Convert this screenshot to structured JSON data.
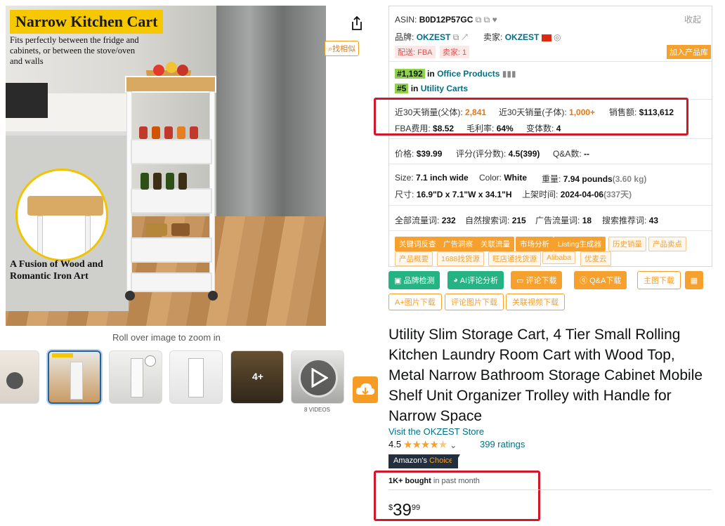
{
  "image": {
    "title": "Narrow Kitchen Cart",
    "subtitle": "Fits perfectly between the fridge and cabinets, or between the stove/oven and walls",
    "caption": "A Fusion of Wood and Romantic Iron Art",
    "roll_over": "Roll over image to zoom in",
    "similar_btn": "找相似",
    "videos_label": "8 VIDEOS",
    "thumb_more": "4+"
  },
  "panel": {
    "asin_label": "ASIN:",
    "asin": "B0D12P57GC",
    "collapse": "收起",
    "brand_label": "品牌:",
    "brand": "OKZEST",
    "seller_label": "卖家:",
    "seller": "OKZEST",
    "tag_fba": "配送: FBA",
    "tag_sellers": "卖家: 1",
    "add_btn": "加入产品库",
    "rank1": "#1,192",
    "rank1_in": "in",
    "rank1_cat": "Office Products",
    "rank2": "#5",
    "rank2_in": "in",
    "rank2_cat": "Utility Carts",
    "sales_parent_label": "近30天销量(父体):",
    "sales_parent": "2,841",
    "sales_child_label": "近30天销量(子体):",
    "sales_child": "1,000+",
    "revenue_label": "销售额:",
    "revenue": "$113,612",
    "fba_label": "FBA费用:",
    "fba": "$8.52",
    "margin_label": "毛利率:",
    "margin": "64%",
    "variants_label": "变体数:",
    "variants": "4",
    "price_label": "价格:",
    "price": "$39.99",
    "score_label": "评分(评分数):",
    "score": "4.5(399)",
    "qa_label": "Q&A数:",
    "qa": "--",
    "size_label": "Size:",
    "size": "7.1 inch wide",
    "color_label": "Color:",
    "color": "White",
    "weight_label": "重量:",
    "weight": "7.94 pounds",
    "weight_kg": "(3.60 kg)",
    "dim_label": "尺寸:",
    "dim": "16.9\"D x 7.1\"W x 34.1\"H",
    "listed_label": "上架时间:",
    "listed": "2024-04-06",
    "listed_days": "(337天)",
    "traffic_all_label": "全部流量词:",
    "traffic_all": "232",
    "traffic_nat_label": "自然搜索词:",
    "traffic_nat": "215",
    "traffic_ad_label": "广告流量词:",
    "traffic_ad": "18",
    "traffic_rec_label": "搜索推荐词:",
    "traffic_rec": "43",
    "chips_row1": [
      "关键词反查",
      "广告洞察",
      "关联流量",
      "市场分析",
      "Listing生成器",
      "历史销量",
      "产品卖点"
    ],
    "chips_row2": [
      "产品概要",
      "1688找货源",
      "旺店通找货源",
      "Alibaba",
      "优麦云"
    ]
  },
  "actions": {
    "brand_check": "品牌检测",
    "ai_review": "AI评论分析",
    "review_dl": "评论下载",
    "qa_dl": "Q&A下载",
    "main_img_dl": "主图下载",
    "aplus_dl": "A+图片下载",
    "review_img_dl": "评论图片下载",
    "video_dl": "关联视频下载"
  },
  "product": {
    "title": "Utility Slim Storage Cart, 4 Tier Small Rolling Kitchen Laundry Room Cart with Wood Top, Metal Narrow Bathroom Storage Cabinet Mobile Shelf Unit Organizer Trolley with Handle for Narrow Space",
    "store": "Visit the OKZEST Store",
    "rating": "4.5",
    "ratings_count": "399 ratings",
    "choice_a": "Amazon's",
    "choice_b": "Choice",
    "bought_bold": "1K+ bought",
    "bought_rest": "in past month",
    "price_symbol": "$",
    "price_whole": "39",
    "price_frac": "99"
  }
}
